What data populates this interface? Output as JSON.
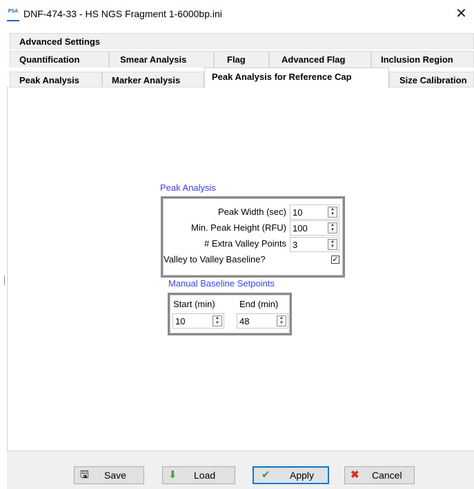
{
  "window": {
    "icon_text": "PSA",
    "title": "DNF-474-33 - HS NGS Fragment 1-6000bp.ini",
    "close_glyph": "✕"
  },
  "tabs": {
    "row1": [
      "Advanced Settings"
    ],
    "row2": [
      "Quantification",
      "Smear Analysis",
      "Flag",
      "Advanced Flag",
      "Inclusion Region"
    ],
    "row3": [
      "Peak Analysis",
      "Marker Analysis",
      "Peak Analysis for Reference Cap",
      "Size Calibration"
    ],
    "active": "Peak Analysis for Reference Cap"
  },
  "peak_analysis": {
    "title": "Peak Analysis",
    "peak_width_label": "Peak Width (sec)",
    "peak_width_value": "10",
    "min_peak_height_label": "Min. Peak Height (RFU)",
    "min_peak_height_value": "100",
    "extra_valley_label": "# Extra Valley Points",
    "extra_valley_value": "3",
    "valley_baseline_label": "Valley to Valley Baseline?",
    "valley_baseline_checked": true
  },
  "manual_baseline": {
    "title": "Manual Baseline Setpoints",
    "start_label": "Start  (min)",
    "start_value": "10",
    "end_label": "End (min)",
    "end_value": "48"
  },
  "buttons": {
    "save": "Save",
    "load": "Load",
    "apply": "Apply",
    "cancel": "Cancel"
  },
  "icons": {
    "save": "floppy-icon",
    "load": "down-arrow-icon",
    "apply": "checkmark-icon",
    "cancel": "x-icon"
  },
  "colors": {
    "section_title": "#3d3df5",
    "apply_border": "#0078d7",
    "cancel_icon": "#d93025",
    "apply_icon": "#2e9e3a",
    "load_icon": "#3aa83a"
  }
}
